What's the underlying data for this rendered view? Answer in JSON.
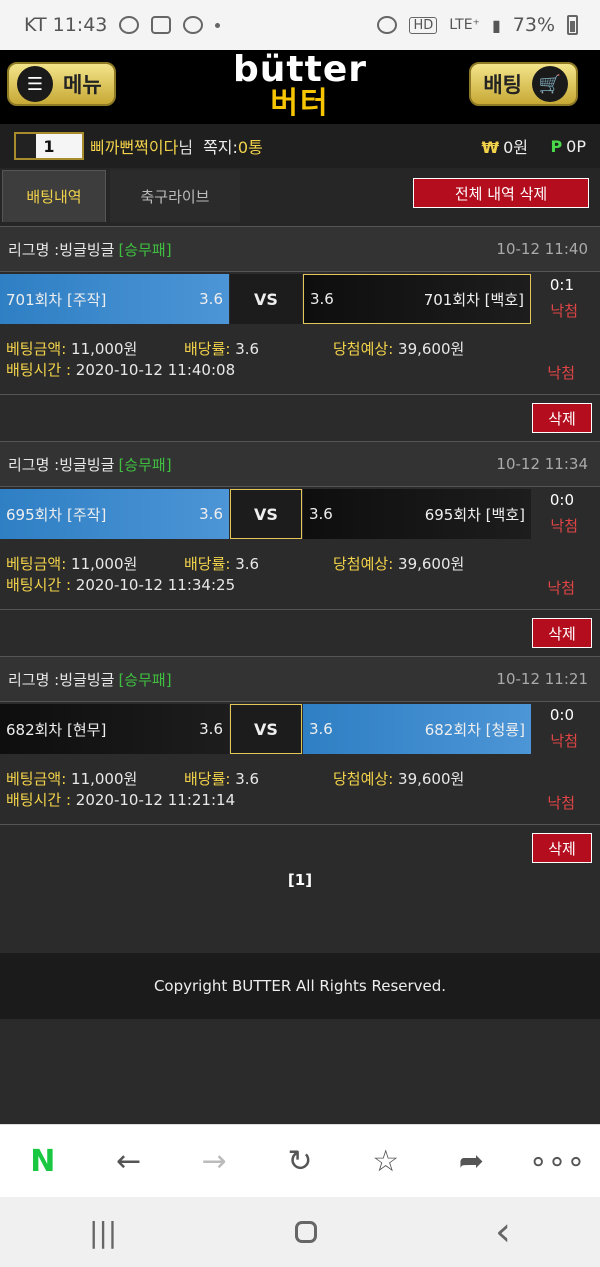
{
  "status": {
    "carrier_time": "KT 11:43",
    "hd": "HD",
    "network": "LTE⁺",
    "battery": "73%"
  },
  "header": {
    "menu_label": "메뉴",
    "logo_top": "bütter",
    "logo_bottom": "버터",
    "bet_label": "배팅"
  },
  "user": {
    "level_badge": "1",
    "name": "삐까뻔쩍이다",
    "name_suffix": "님",
    "notes_label": "쪽지:",
    "notes_value": "0통",
    "money_symbol": "₩",
    "money": "0원",
    "point_symbol": "P",
    "point": "0P"
  },
  "tabs": {
    "history": "배팅내역",
    "live": "축구라이브",
    "delete_all": "전체 내역 삭제"
  },
  "labels": {
    "league": "리그명 : ",
    "amount": "베팅금액:",
    "rate": "배당률:",
    "win": "당첨예상:",
    "time": "배팅시간 :",
    "vs": "VS",
    "delete": "삭제"
  },
  "bets": [
    {
      "league": "빙글빙글",
      "type": "[승무패]",
      "datetime": "10-12 11:40",
      "home": "701회차 [주작]",
      "home_odds": "3.6",
      "away_odds": "3.6",
      "away": "701회차 [백호]",
      "score": "0:1",
      "result": "낙첨",
      "amount": " 11,000원",
      "rate": " 3.6",
      "win": " 39,600원",
      "time": " 2020-10-12 11:40:08",
      "result2": "낙첨"
    },
    {
      "league": "빙글빙글",
      "type": "[승무패]",
      "datetime": "10-12 11:34",
      "home": "695회차 [주작]",
      "home_odds": "3.6",
      "away_odds": "3.6",
      "away": "695회차 [백호]",
      "score": "0:0",
      "result": "낙첨",
      "amount": " 11,000원",
      "rate": " 3.6",
      "win": " 39,600원",
      "time": " 2020-10-12 11:34:25",
      "result2": "낙첨"
    },
    {
      "league": "빙글빙글",
      "type": "[승무패]",
      "datetime": "10-12 11:21",
      "home": "682회차 [현무]",
      "home_odds": "3.6",
      "away_odds": "3.6",
      "away": "682회차 [청룡]",
      "score": "0:0",
      "result": "낙첨",
      "amount": " 11,000원",
      "rate": " 3.6",
      "win": " 39,600원",
      "time": " 2020-10-12 11:21:14",
      "result2": "낙첨"
    }
  ],
  "pager": "[1]",
  "footer": "Copyright BUTTER All Rights Reserved.",
  "browser": {
    "naver": "N",
    "back": "←",
    "forward": "→",
    "reload": "↻",
    "bookmark": "☆",
    "share": "➦",
    "more": "∘∘∘"
  },
  "navbar": {
    "recents": "|||",
    "back": "‹"
  },
  "colors": {
    "accent_gold": "#f2d24a",
    "selected_blue": "#3f8acc",
    "delete_red": "#b30d1e",
    "win_green": "#3fbf3f"
  }
}
